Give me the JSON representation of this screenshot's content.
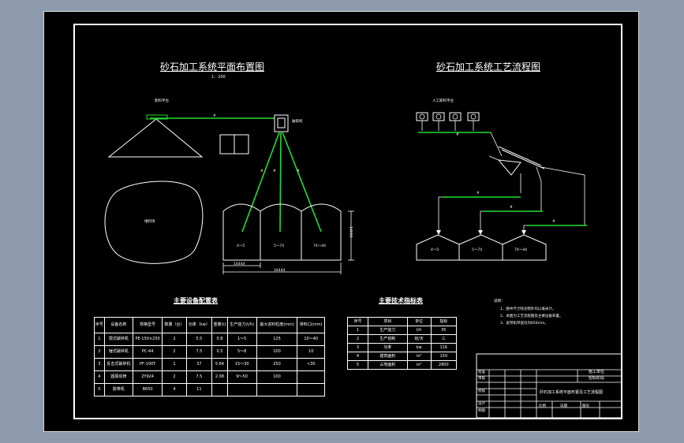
{
  "plan": {
    "title": "砂石加工系统平面布置图",
    "scale": "1：200",
    "labels": {
      "hopper": "卸料平台",
      "stockpile": "堆料场",
      "crusher": "破碎机",
      "belt_mark": "#",
      "bin_1": "4～5",
      "bin_2": "5～74",
      "bin_3": "74～44",
      "dim_total": "34444",
      "dim_part": "14444",
      "dim_side": "14000"
    }
  },
  "flow": {
    "title": "砂石加工系统工艺流程图",
    "labels": {
      "feed": "人工卸料平台",
      "bin_1": "4～5",
      "bin_2": "5～74",
      "bin_3": "74～44",
      "belt_mark": "#"
    }
  },
  "equip_table": {
    "title": "主要设备配置表",
    "headers": [
      "序号",
      "设备名称",
      "规格型号",
      "数量（台）",
      "功率（kw）",
      "重量(t)",
      "生产能力(t/h)",
      "最大进料粒度(mm)",
      "排料口(mm)"
    ],
    "rows": [
      [
        "1",
        "颚式破碎机",
        "PE-150×250",
        "2",
        "5.5",
        "0.8",
        "1～5",
        "125",
        "10～40"
      ],
      [
        "2",
        "锤式破碎机",
        "PC-44",
        "2",
        "7.5",
        "0.5",
        "5～8",
        "100",
        "10"
      ],
      [
        "3",
        "反击式破碎机",
        "PF-100T",
        "1",
        "37",
        "5.64",
        "15～30",
        "250",
        "<30"
      ],
      [
        "4",
        "圆振动筛",
        "2Y924",
        "2",
        "7.5",
        "2.08",
        "9～50",
        "100",
        ""
      ],
      [
        "5",
        "胶带机",
        "B650",
        "4",
        "11",
        "",
        "",
        "",
        ""
      ]
    ]
  },
  "tech_table": {
    "title": "主要技术指标表",
    "headers": [
      "序号",
      "项目",
      "单位",
      "指标"
    ],
    "rows": [
      [
        "1",
        "生产能力",
        "t/h",
        "35"
      ],
      [
        "2",
        "生产班制",
        "班/天",
        "三"
      ],
      [
        "3",
        "功率",
        "kw",
        "116"
      ],
      [
        "4",
        "建筑面积",
        "m²",
        "150"
      ],
      [
        "5",
        "占地面积",
        "m²",
        "2800"
      ]
    ]
  },
  "notes": {
    "heading": "说明：",
    "items": [
      "1、图中尺寸除注明外均以毫米计。",
      "2、本图为工艺流程图及主要设备布置。",
      "3、皮带机带宽均为650mm。"
    ]
  },
  "title_block": {
    "org": "施工单位",
    "stage": "招标阶段",
    "drawing_name": "砂石加工系统平面布置及工艺流程图",
    "left_col": [
      "批准",
      "审核",
      "校核",
      "设计",
      "制图"
    ],
    "bottom": [
      "比例",
      "日期",
      "图号"
    ]
  },
  "colors": {
    "belt": "#22dd33",
    "line": "#ffffff",
    "background": "#000000"
  }
}
